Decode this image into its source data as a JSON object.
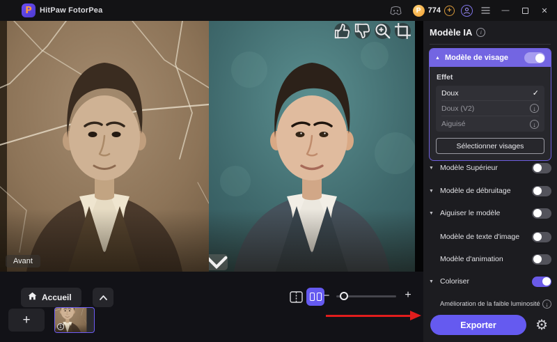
{
  "titlebar": {
    "app_title": "HitPaw FotorPea",
    "credits": "774"
  },
  "icons": {
    "logo_letter": "P",
    "coin_letter": "P",
    "add_credit": "+",
    "check": "✓",
    "download_arrow": "↓",
    "triangle_up": "▲",
    "triangle_down": "▼",
    "info": "i",
    "minimize": "—",
    "close": "✕",
    "minus": "−",
    "plus": "+",
    "badge_number": "1"
  },
  "viewer": {
    "before_label": "Avant"
  },
  "bottombar": {
    "home_label": "Accueil",
    "add_label": "+",
    "zoom_minus": "−",
    "zoom_plus": "+"
  },
  "sidebar": {
    "title": "Modèle IA",
    "face_model": {
      "label": "Modèle de visage",
      "enabled": true,
      "effect_label": "Effet",
      "effects": [
        {
          "label": "Doux",
          "selected": true
        },
        {
          "label": "Doux (V2)",
          "selected": false
        },
        {
          "label": "Aiguisé",
          "selected": false
        }
      ],
      "select_faces_label": "Sélectionner visages"
    },
    "toggles": [
      {
        "label": "Modèle Supérieur",
        "on": false
      },
      {
        "label": "Modèle de débruitage",
        "on": false
      },
      {
        "label": "Aiguiser le modèle",
        "on": false
      },
      {
        "label": "Modèle de texte d'image",
        "on": false
      },
      {
        "label": "Modèle d'animation",
        "on": false
      },
      {
        "label": "Coloriser",
        "on": true
      }
    ],
    "low_light_label": "Amélioration de la faible luminosité",
    "export_label": "Exporter"
  },
  "colors": {
    "accent": "#655af0",
    "accent_header": "#7365e2",
    "arrow_red": "#e11d1d",
    "coin_gold": "#ef9d2e"
  }
}
